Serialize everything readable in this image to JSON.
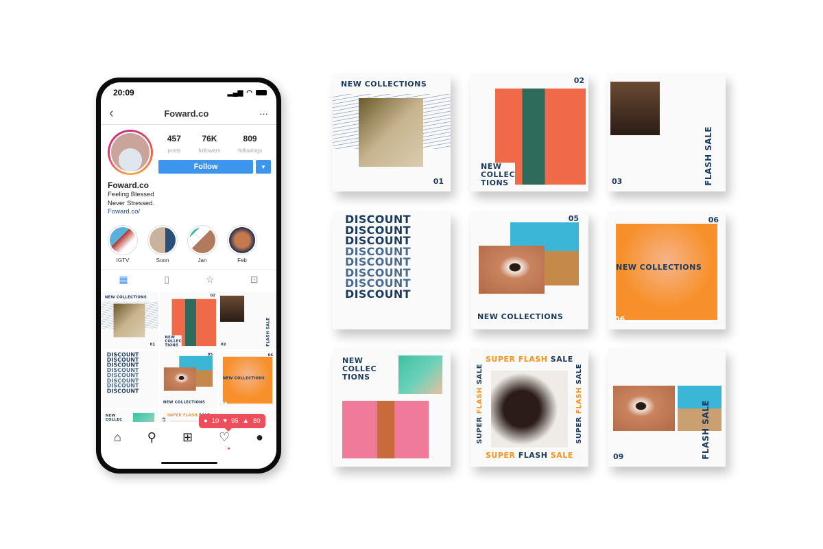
{
  "phone": {
    "status": {
      "time": "20:09"
    },
    "nav": {
      "back": "‹",
      "title": "Foward.co",
      "more": "···"
    },
    "profile": {
      "posts": "457",
      "posts_label": "posts",
      "followers": "76K",
      "followers_label": "followers",
      "followings": "809",
      "followings_label": "followings",
      "follow": "Follow",
      "dropdown": "▼",
      "name": "Foward.co",
      "bio1": "Feeling Blessed",
      "bio2": "Never Stressed.",
      "link": "Foward.co/"
    },
    "highlights": [
      "IGTV",
      "Soon",
      "Jan",
      "Feb"
    ],
    "notification": {
      "comments": "10",
      "likes": "95",
      "follows": "80"
    }
  },
  "colors": {
    "navy": "#1b3a5c",
    "orange": "#f7931e",
    "instagram_blue": "#3d95ee",
    "notification_red": "#ee4e5b"
  },
  "cards": [
    {
      "title": "NEW COLLECTIONS",
      "num": "01"
    },
    {
      "title1": "NEW",
      "title2": "COLLEC",
      "title3": "TIONS",
      "num": "02"
    },
    {
      "title": "FLASH SALE",
      "num": "03"
    },
    {
      "word": "DISCOUNT"
    },
    {
      "title": "NEW COLLECTIONS",
      "num": "05"
    },
    {
      "title": "NEW COLLECTIONS",
      "num": "06"
    },
    {
      "title1": "NEW",
      "title2": "COLLEC",
      "title3": "TIONS"
    },
    {
      "super": "SUPER",
      "flash": "FLASH",
      "sale": "SALE"
    },
    {
      "title": "FLASH SALE",
      "num": "09"
    }
  ]
}
